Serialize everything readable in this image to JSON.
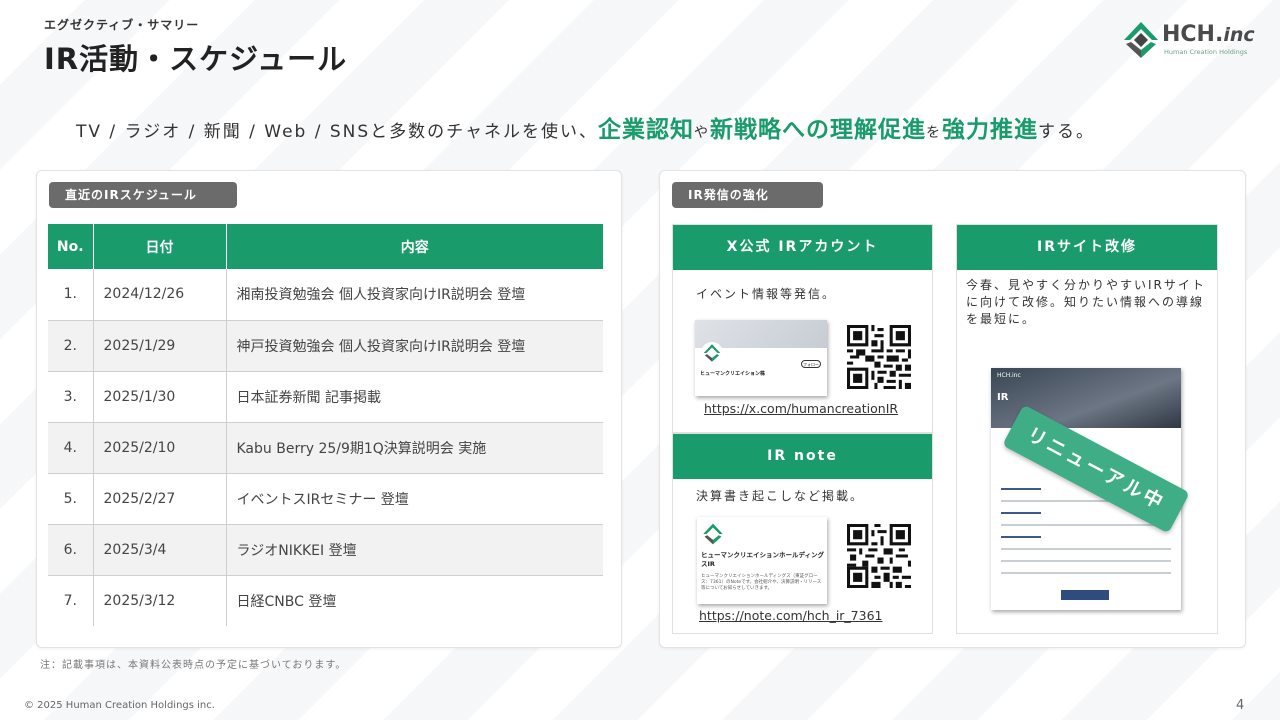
{
  "header": {
    "section_label": "エグゼクティブ・サマリー",
    "title": "IR活動・スケジュール",
    "logo_text": "HCH.",
    "logo_inc": "inc",
    "logo_sub": "Human Creation Holdings"
  },
  "lead": {
    "part1": "TV / ラジオ / 新聞 / Web / SNSと多数のチャネルを使い、",
    "hl1": "企業認知",
    "part2": "や",
    "hl2": "新戦略への理解促進",
    "part3": "を",
    "hl3": "強力推進",
    "part4": "する。"
  },
  "schedule": {
    "label": "直近のIRスケジュール",
    "headers": [
      "No.",
      "日付",
      "内容"
    ],
    "rows": [
      {
        "no": "1.",
        "date": "2024/12/26",
        "content": "湘南投資勉強会 個人投資家向けIR説明会 登壇"
      },
      {
        "no": "2.",
        "date": "2025/1/29",
        "content": "神戸投資勉強会 個人投資家向けIR説明会 登壇"
      },
      {
        "no": "3.",
        "date": "2025/1/30",
        "content": "日本証券新聞 記事掲載"
      },
      {
        "no": "4.",
        "date": "2025/2/10",
        "content": "Kabu Berry 25/9期1Q決算説明会 実施"
      },
      {
        "no": "5.",
        "date": "2025/2/27",
        "content": "イベントスIRセミナー 登壇"
      },
      {
        "no": "6.",
        "date": "2025/3/4",
        "content": "ラジオNIKKEI 登壇"
      },
      {
        "no": "7.",
        "date": "2025/3/12",
        "content": "日経CNBC 登壇"
      }
    ]
  },
  "ir_strength": {
    "label": "IR発信の強化",
    "x_card": {
      "title": "X公式 IRアカウント",
      "desc": "イベント情報等発信。",
      "link": "https://x.com/humancreationIR",
      "thumb_name": "ヒューマンクリエイション株",
      "thumb_btn": "フォロー"
    },
    "note_card": {
      "title": "IR note",
      "desc": "決算書き起こしなど掲載。",
      "link": "https://note.com/hch_ir_7361",
      "thumb_name": "ヒューマンクリエイションホールディングスIR",
      "thumb_sub": "ヒューマンクリエイションホールディングス（東証グロース：7361）のNoteです。会社紹介や、決算説明・リリース等についてお知らせしていきます。"
    },
    "site_card": {
      "title": "IRサイト改修",
      "desc": "今春、見やすく分かりやすいIRサイトに向けて改修。知りたい情報への導線を最短に。",
      "thumb_ir": "IR",
      "thumb_logo": "HCH.inc",
      "ribbon": "リニューアル中"
    }
  },
  "footer": {
    "note": "注：記載事項は、本資料公表時点の予定に基づいております。",
    "copyright": "© 2025 Human Creation Holdings inc.",
    "page": "4"
  },
  "colors": {
    "accent": "#1a9b6c",
    "ribbon": "#3fae86",
    "pill": "#6b6b6b"
  }
}
